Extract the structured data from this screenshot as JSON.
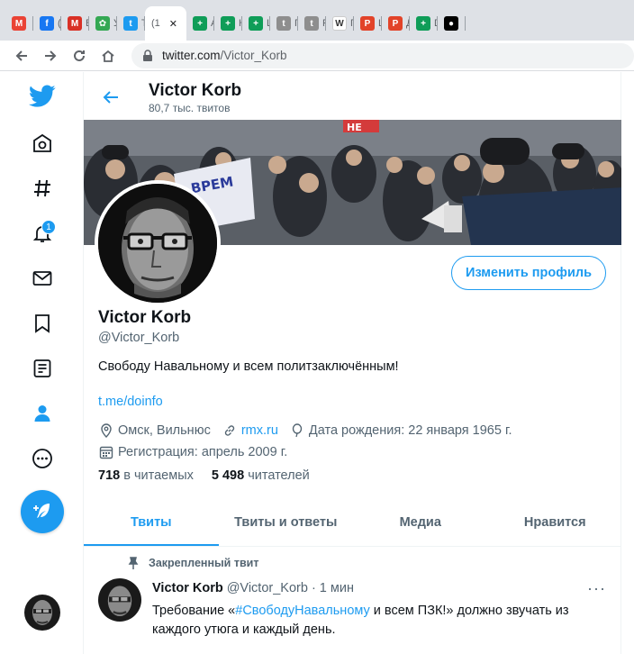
{
  "browser": {
    "tabs": [
      {
        "letter": "M",
        "title": "",
        "color": "#ea4335"
      },
      {
        "letter": "f",
        "title": "(",
        "color": "#1877f2"
      },
      {
        "letter": "M",
        "title": "В",
        "color": "#d93025"
      },
      {
        "letter": "✿",
        "title": "У",
        "color": "#34a853"
      },
      {
        "letter": "t",
        "title": "T",
        "color": "#1d9bf0"
      },
      {
        "letter": "",
        "title": "(1",
        "color": "#ffffff",
        "active": true
      },
      {
        "letter": "+",
        "title": "А",
        "color": "#0f9d58"
      },
      {
        "letter": "+",
        "title": "К",
        "color": "#0f9d58"
      },
      {
        "letter": "+",
        "title": "L",
        "color": "#0f9d58"
      },
      {
        "letter": "t",
        "title": "Г",
        "color": "#8e8e8e"
      },
      {
        "letter": "t",
        "title": "Р",
        "color": "#8e8e8e"
      },
      {
        "letter": "W",
        "title": "Г",
        "color": "#ffffff"
      },
      {
        "letter": "P",
        "title": "L",
        "color": "#e24329"
      },
      {
        "letter": "P",
        "title": "Д",
        "color": "#e24329"
      },
      {
        "letter": "+",
        "title": "D",
        "color": "#0f9d58"
      },
      {
        "letter": "●",
        "title": "",
        "color": "#000000"
      }
    ],
    "close_glyph": "✕",
    "url_host": "twitter.com",
    "url_path": "/Victor_Korb"
  },
  "sidebar": {
    "notifications_badge": "1"
  },
  "header": {
    "name": "Victor Korb",
    "tweet_count": "80,7 тыс. твитов"
  },
  "profile": {
    "edit_button": "Изменить профиль",
    "name": "Victor Korb",
    "handle": "@Victor_Korb",
    "bio": "Свободу Навальному и всем политзаключённым!",
    "link": "t.me/doinfo",
    "location": "Омск, Вильнюс",
    "website": "rmx.ru",
    "birthday": "Дата рождения: 22 января 1965 г.",
    "joined": "Регистрация: апрель 2009 г.",
    "following_count": "718",
    "following_label": "в читаемых",
    "followers_count": "5 498",
    "followers_label": "читателей",
    "banner_sign_1": "ВРЕМ",
    "banner_sign_2": "НЕ"
  },
  "tabs": [
    "Твиты",
    "Твиты и ответы",
    "Медиа",
    "Нравится"
  ],
  "tweet": {
    "pinned_label": "Закрепленный твит",
    "author": "Victor Korb",
    "meta": "@Victor_Korb · 1 мин",
    "text_before": "Требование «",
    "hashtag": "#СвободуНавальному",
    "text_after": " и всем ПЗК!» должно звучать из каждого утюга и каждый день.",
    "more": "···"
  },
  "colors": {
    "accent": "#1d9bf0",
    "text": "#0f1419",
    "muted": "#536471"
  }
}
